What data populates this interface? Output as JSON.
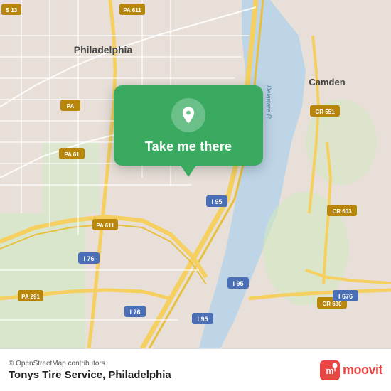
{
  "map": {
    "background_color": "#e8e0d8"
  },
  "popup": {
    "button_label": "Take me there",
    "background_color": "#3aaa60"
  },
  "bottom_bar": {
    "attribution": "© OpenStreetMap contributors",
    "place_name": "Tonys Tire Service, Philadelphia",
    "moovit_label": "moovit"
  }
}
